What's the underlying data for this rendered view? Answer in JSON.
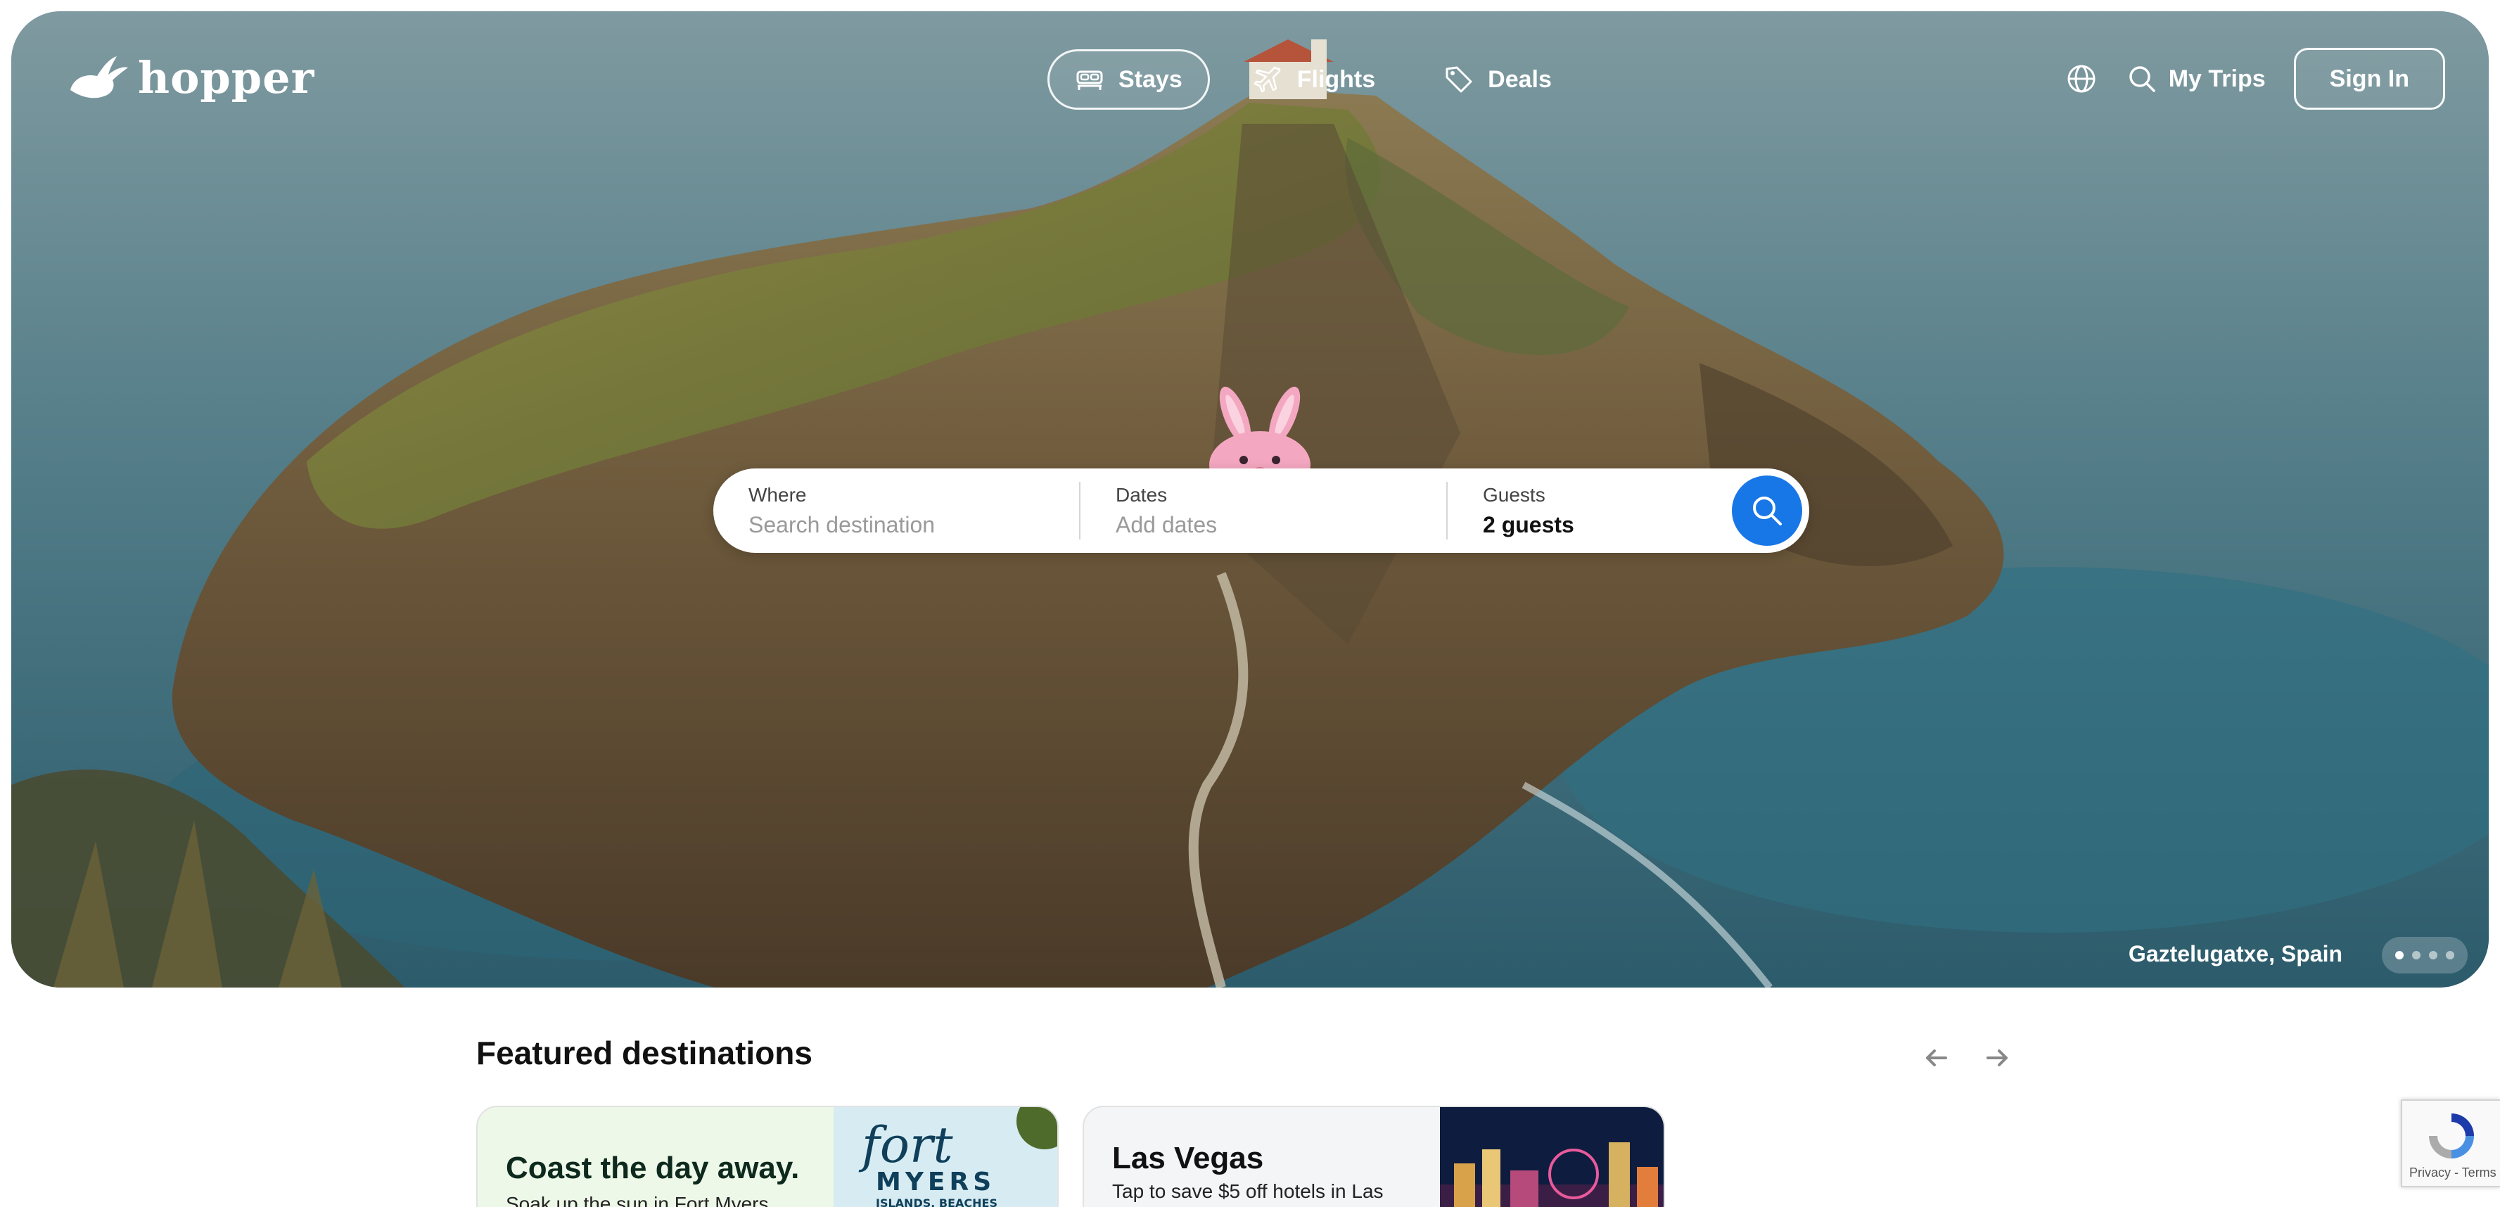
{
  "brand": {
    "name": "hopper"
  },
  "nav": {
    "tabs": [
      {
        "label": "Stays",
        "icon": "bed-icon",
        "active": true
      },
      {
        "label": "Flights",
        "icon": "plane-icon",
        "active": false
      },
      {
        "label": "Deals",
        "icon": "tag-icon",
        "active": false
      }
    ],
    "my_trips": "My Trips",
    "sign_in": "Sign In"
  },
  "search": {
    "where_label": "Where",
    "where_placeholder": "Search destination",
    "dates_label": "Dates",
    "dates_placeholder": "Add dates",
    "guests_label": "Guests",
    "guests_value": "2 guests"
  },
  "hero": {
    "caption": "Gaztelugatxe, Spain",
    "slides": 4,
    "active_slide": 1
  },
  "featured": {
    "title": "Featured destinations",
    "cards": [
      {
        "title": "Coast the day away.",
        "subtitle": "Soak up the sun in Fort Myers",
        "image_text": "fort MYERS ISLANDS, BEACHES & NEIGHBORHOODS"
      },
      {
        "title": "Las Vegas",
        "subtitle": "Tap to save $5 off hotels in Las"
      }
    ]
  },
  "recaptcha": {
    "text": "Privacy - Terms"
  },
  "colors": {
    "accent": "#1877e6",
    "card_green": "#eef8e8",
    "mascot_pink": "#f4a7c0"
  }
}
